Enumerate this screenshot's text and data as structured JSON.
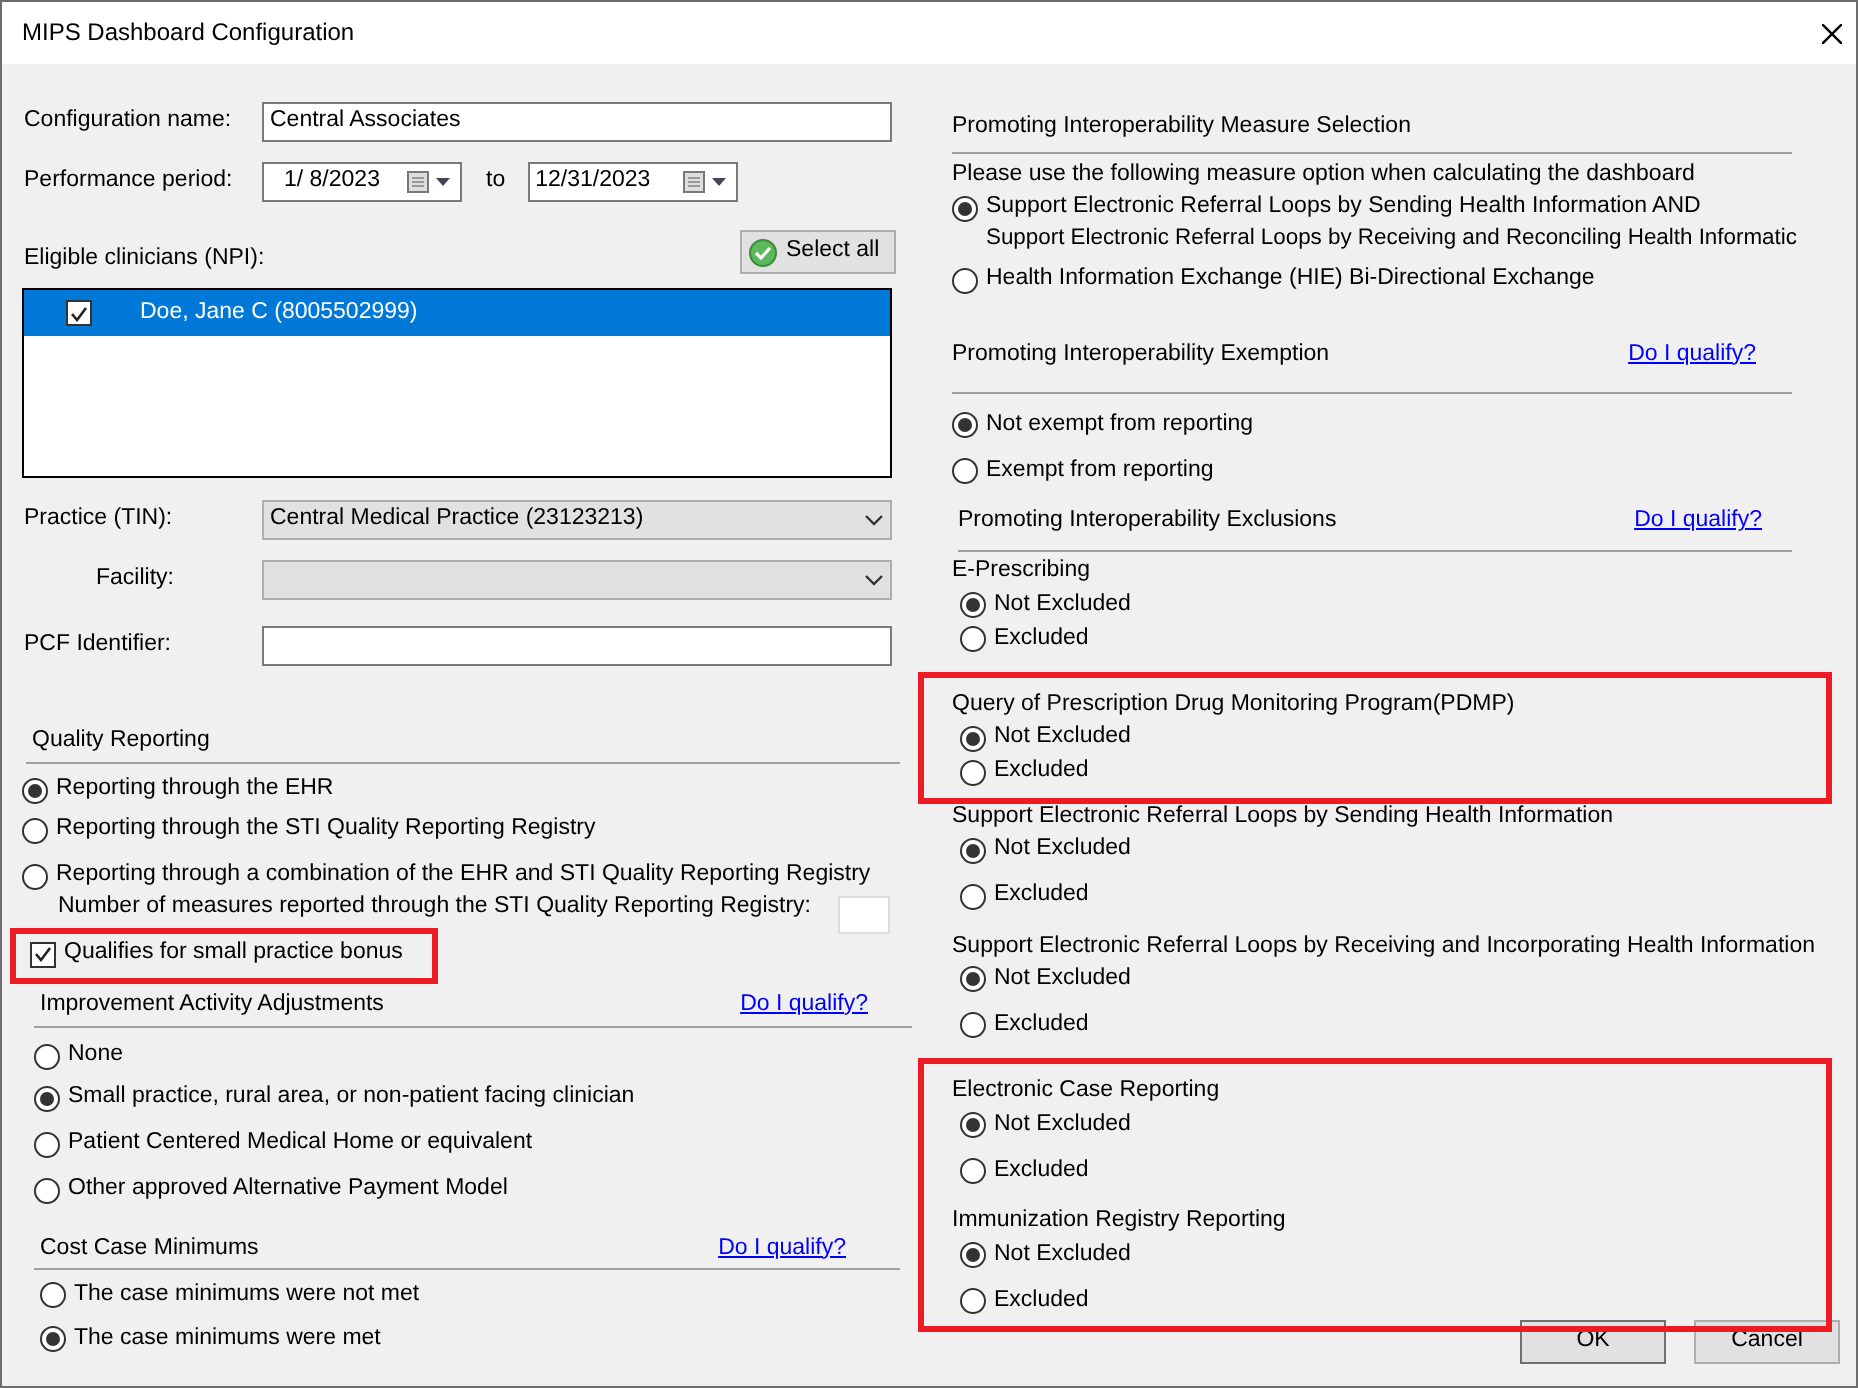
{
  "window": {
    "title": "MIPS Dashboard Configuration"
  },
  "config": {
    "name_label": "Configuration name:",
    "name_value": "Central Associates",
    "period_label": "Performance period:",
    "period_from": "1/  8/2023",
    "period_to_label": "to",
    "period_to": "12/31/2023",
    "clinicians_label": "Eligible clinicians (NPI):",
    "select_all": "Select all",
    "clinicians": [
      {
        "name": "Doe, Jane C (8005502999)",
        "checked": true,
        "selected": true
      }
    ],
    "practice_label": "Practice (TIN):",
    "practice_value": "Central Medical Practice (23123213)",
    "facility_label": "Facility:",
    "pcf_label": "PCF Identifier:"
  },
  "quality_reporting": {
    "title": "Quality Reporting",
    "options": [
      {
        "label": "Reporting through the EHR",
        "selected": true
      },
      {
        "label": "Reporting through the STI Quality Reporting Registry",
        "selected": false
      },
      {
        "label": "Reporting through a combination of the EHR and STI Quality Reporting Registry",
        "selected": false
      }
    ],
    "measures_label": "Number of measures reported through the STI Quality Reporting Registry:",
    "small_practice": {
      "label": "Qualifies for small practice bonus",
      "checked": true,
      "highlighted": true
    }
  },
  "improvement": {
    "title": "Improvement Activity Adjustments",
    "link": "Do I qualify?",
    "options": [
      {
        "label": "None",
        "selected": false
      },
      {
        "label": "Small practice, rural area, or non-patient facing clinician",
        "selected": true
      },
      {
        "label": "Patient Centered Medical Home or equivalent",
        "selected": false
      },
      {
        "label": "Other approved Alternative Payment Model",
        "selected": false
      }
    ]
  },
  "cost": {
    "title": "Cost Case Minimums",
    "link": "Do I qualify?",
    "options": [
      {
        "label": "The case minimums were not met",
        "selected": false
      },
      {
        "label": "The case minimums were met",
        "selected": true
      }
    ]
  },
  "pi_selection": {
    "title": "Promoting Interoperability Measure Selection",
    "instruction": "Please use the following measure option when calculating the dashboard",
    "options": [
      {
        "label": "Support Electronic Referral Loops by Sending Health Information AND",
        "second_line": "Support Electronic Referral Loops by Receiving and Reconciling Health Informatic",
        "selected": true
      },
      {
        "label": "Health Information Exchange (HIE) Bi-Directional Exchange",
        "selected": false
      }
    ]
  },
  "pi_exemption": {
    "title": "Promoting Interoperability Exemption",
    "link": "Do I qualify?",
    "options": [
      {
        "label": "Not exempt from reporting",
        "selected": true
      },
      {
        "label": "Exempt from reporting",
        "selected": false
      }
    ]
  },
  "pi_exclusions": {
    "title": "Promoting Interoperability Exclusions",
    "link": "Do I qualify?",
    "measures": [
      {
        "name": "E-Prescribing",
        "highlighted": false,
        "options": [
          {
            "label": "Not Excluded",
            "selected": true
          },
          {
            "label": "Excluded",
            "selected": false
          }
        ]
      },
      {
        "name": "Query of Prescription Drug Monitoring Program(PDMP)",
        "highlighted": true,
        "options": [
          {
            "label": "Not Excluded",
            "selected": true
          },
          {
            "label": "Excluded",
            "selected": false
          }
        ]
      },
      {
        "name": "Support Electronic Referral Loops by Sending Health Information",
        "highlighted": false,
        "options": [
          {
            "label": "Not Excluded",
            "selected": true
          },
          {
            "label": "Excluded",
            "selected": false
          }
        ]
      },
      {
        "name": "Support Electronic Referral Loops by Receiving and Incorporating Health Information",
        "highlighted": false,
        "options": [
          {
            "label": "Not Excluded",
            "selected": true
          },
          {
            "label": "Excluded",
            "selected": false
          }
        ]
      },
      {
        "name": "Electronic Case Reporting",
        "highlighted": true,
        "options": [
          {
            "label": "Not Excluded",
            "selected": true
          },
          {
            "label": "Excluded",
            "selected": false
          }
        ]
      },
      {
        "name": "Immunization Registry Reporting",
        "highlighted": true,
        "options": [
          {
            "label": "Not Excluded",
            "selected": true
          },
          {
            "label": "Excluded",
            "selected": false
          }
        ]
      }
    ]
  },
  "buttons": [
    {
      "label": "OK",
      "kind": "default"
    },
    {
      "label": "Cancel",
      "kind": "normal"
    }
  ]
}
